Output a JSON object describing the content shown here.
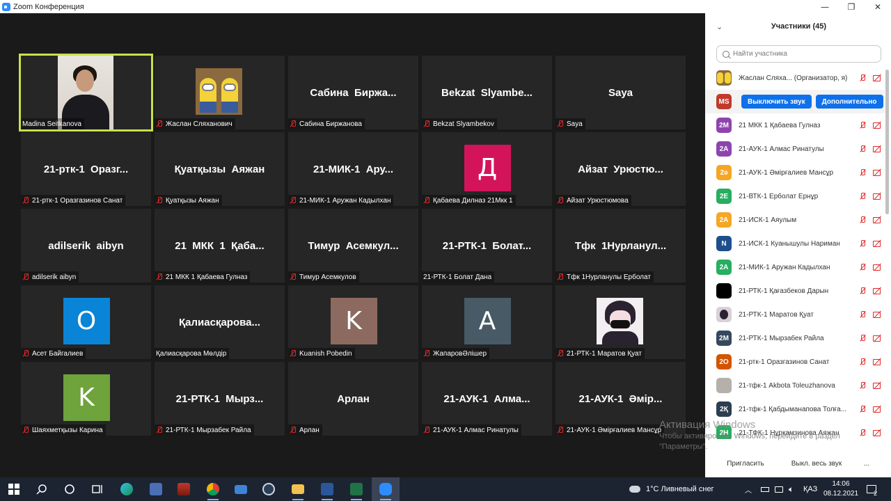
{
  "window": {
    "title": "Zoom Конференция",
    "minimize_glyph": "—",
    "maximize_glyph": "❐",
    "close_glyph": "✕"
  },
  "tiles": [
    {
      "name": "Madina Seitkanova",
      "muted": false,
      "kind": "video",
      "active": true
    },
    {
      "name": "Жаслан Сляханович",
      "muted": true,
      "kind": "minion"
    },
    {
      "name": "Сабина Биржанова",
      "muted": true,
      "kind": "text",
      "display": "Сабина  Биржа..."
    },
    {
      "name": "Bekzat Slyambekov",
      "muted": true,
      "kind": "text",
      "display": "Bekzat  Slyambe..."
    },
    {
      "name": "Saya",
      "muted": true,
      "kind": "text",
      "display": "Saya"
    },
    {
      "name": "21-ртк-1 Оразгазинов Санат",
      "muted": true,
      "kind": "text",
      "display": "21-ртк-1  Оразг..."
    },
    {
      "name": "Қуатқызы Аяжан",
      "muted": true,
      "kind": "text",
      "display": "Қуатқызы  Аяжан"
    },
    {
      "name": "21-МИК-1 Аружан Кадылхан",
      "muted": true,
      "kind": "text",
      "display": "21-МИК-1  Ару..."
    },
    {
      "name": "Қабаева Дилназ 21Мкк 1",
      "muted": true,
      "kind": "avatar",
      "letter": "Д",
      "color": "#d3145a"
    },
    {
      "name": "Айзат Урюстюмова",
      "muted": true,
      "kind": "text",
      "display": "Айзат  Урюстю..."
    },
    {
      "name": "adilserik aibyn",
      "muted": true,
      "kind": "text",
      "display": "adilserik  aibyn"
    },
    {
      "name": "21 МКК 1 Қабаева Гулназ",
      "muted": true,
      "kind": "text",
      "display": "21  МКК  1  Қаба..."
    },
    {
      "name": "Тимур Асемкулов",
      "muted": true,
      "kind": "text",
      "display": "Тимур  Асемкул..."
    },
    {
      "name": "21-РТК-1 Болат Дана",
      "muted": false,
      "kind": "text",
      "display": "21-РТК-1  Болат..."
    },
    {
      "name": "Тфк 1Нурланулы Ерболат",
      "muted": true,
      "kind": "text",
      "display": "Тфк  1Нурланул..."
    },
    {
      "name": "Асет Байгалиев",
      "muted": true,
      "kind": "avatar",
      "letter": "О",
      "color": "#0a84d6"
    },
    {
      "name": "Қалиасқарова Мөлдір",
      "muted": false,
      "kind": "text",
      "display": "Қалиасқарова..."
    },
    {
      "name": "Kuanish Pobedin",
      "muted": true,
      "kind": "avatar",
      "letter": "K",
      "color": "#8d6a5f"
    },
    {
      "name": "ЖапаровӘлішер",
      "muted": true,
      "kind": "avatar",
      "letter": "A",
      "color": "#475a66"
    },
    {
      "name": "21-РТК-1 Маратов Қуат",
      "muted": true,
      "kind": "anime"
    },
    {
      "name": "Шаяхметқызы Карина",
      "muted": true,
      "kind": "avatar",
      "letter": "K",
      "color": "#6fa33b"
    },
    {
      "name": "21-РТК-1 Мырзабек Райла",
      "muted": true,
      "kind": "text",
      "display": "21-РТК-1  Мырз..."
    },
    {
      "name": "Арлан",
      "muted": true,
      "kind": "text",
      "display": "Арлан"
    },
    {
      "name": "21-АУК-1 Алмас Ринатулы",
      "muted": true,
      "kind": "text",
      "display": "21-АУК-1  Алма..."
    },
    {
      "name": "21-АУК-1 Әмірғалиев Мансұр",
      "muted": true,
      "kind": "text",
      "display": "21-АУК-1  Әмір..."
    }
  ],
  "panel": {
    "collapse_glyph": "⌄",
    "title": "Участники (45)",
    "search_placeholder": "Найти участника",
    "participants": [
      {
        "name": "Жаслан Сляхa... (Организатор, я)",
        "avatar": "",
        "color": "#8a6a3e",
        "kind": "minion"
      },
      {
        "name": "",
        "avatar": "MS",
        "color": "#c0392b",
        "kind": "host-actions",
        "actions": [
          "Выключить звук",
          "Дополнительно"
        ]
      },
      {
        "name": "21 МКК 1 Қабаева Гулназ",
        "avatar": "2M",
        "color": "#8e44ad"
      },
      {
        "name": "21-АУК-1 Алмас Ринатулы",
        "avatar": "2A",
        "color": "#8e44ad"
      },
      {
        "name": "21-АУК-1 Әмірғалиев Мансұр",
        "avatar": "2ə",
        "color": "#f5a623"
      },
      {
        "name": "21-ВТК-1 Ерболат Ернұр",
        "avatar": "2E",
        "color": "#27ae60"
      },
      {
        "name": "21-ИСК-1 Аяулым",
        "avatar": "2A",
        "color": "#f5a623"
      },
      {
        "name": "21-ИСК-1 Куанышулы Нариман",
        "avatar": "N",
        "color": "#1f4e8c"
      },
      {
        "name": "21-МИК-1 Аружан Кадылхан",
        "avatar": "2A",
        "color": "#27ae60"
      },
      {
        "name": "21-РТК-1 Қағазбеков Дарын",
        "avatar": "",
        "color": "#000000"
      },
      {
        "name": "21-РТК-1 Маратов Қуат",
        "avatar": "",
        "color": "#d9d0d8",
        "kind": "anime"
      },
      {
        "name": "21-РТК-1 Мырзабек Райла",
        "avatar": "2M",
        "color": "#34495e"
      },
      {
        "name": "21-ртк-1 Оразгазинов Санат",
        "avatar": "2O",
        "color": "#d35400"
      },
      {
        "name": "21-тфк-1 Akbota Toleuzhanova",
        "avatar": "",
        "color": "#b5b0aa"
      },
      {
        "name": "21-тфк-1 Қабдыманапова Толға...",
        "avatar": "2Қ",
        "color": "#2c3e50"
      },
      {
        "name": "21-ТФК-1 Нұрқамзинова Аяжан",
        "avatar": "2H",
        "color": "#27ae60"
      }
    ],
    "footer": {
      "invite": "Пригласить",
      "mute_all": "Выкл. весь звук",
      "more": "..."
    }
  },
  "watermark": {
    "line1": "Активация Windows",
    "line2": "Чтобы активировать Windows, перейдите в раздел",
    "line3": "\"Параметры\"."
  },
  "taskbar": {
    "weather": "1°C  Ливневый снег",
    "language": "ҚАЗ",
    "time": "14:06",
    "date": "08.12.2021",
    "notifications": "2"
  }
}
